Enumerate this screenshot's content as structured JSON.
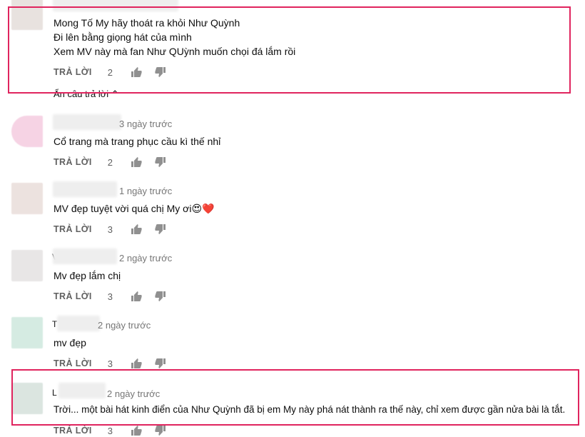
{
  "colors": {
    "highlight": "#e0245e",
    "meta_text": "#767676",
    "action_text": "#606060"
  },
  "comments": [
    {
      "id": "c0",
      "lines": [
        "Mong Tố My hãy thoát ra khỏi Như Quỳnh",
        "Đi lên bằng giọng hát của mình",
        "Xem MV này mà fan Như QUỳnh muốn chọi đá lắm rồi"
      ],
      "reply_label": "TRẢ LỜI",
      "likes": "2",
      "avatar_color": "#e8e2df",
      "hide_replies_label": "Ẩn câu trả lời ⌃"
    },
    {
      "id": "c1",
      "name_initial": "",
      "time": "3 ngày trước",
      "lines": [
        "Cổ trang mà trang phục cầu kì thế nhỉ"
      ],
      "reply_label": "TRẢ LỜI",
      "likes": "2",
      "avatar_color": "#f6d3e4"
    },
    {
      "id": "c2",
      "name_initial": "",
      "time": "1 ngày trước",
      "lines": [
        "MV đẹp tuyệt vời quá chị My ơi"
      ],
      "emoji": "😍❤️",
      "reply_label": "TRẢ LỜI",
      "likes": "3",
      "avatar_color": "#ece2df"
    },
    {
      "id": "c3",
      "name_initial": "V",
      "time": "2 ngày trước",
      "lines": [
        "Mv đẹp lắm chị"
      ],
      "reply_label": "TRẢ LỜI",
      "likes": "3",
      "avatar_color": "#e8e6e6"
    },
    {
      "id": "c4",
      "name_initial": "T",
      "time": "2 ngày trước",
      "lines": [
        "mv đẹp"
      ],
      "reply_label": "TRẢ LỜI",
      "likes": "3",
      "avatar_color": "#d5ebe2"
    },
    {
      "id": "c5",
      "name_initial": "L",
      "time": "2 ngày trước",
      "lines": [
        "Trời... một bài hát kinh điển của Như Quỳnh đã bị em My này phá nát thành ra thế này, chỉ xem được gần nửa bài là tắt."
      ],
      "reply_label": "TRẢ LỜI",
      "likes": "3",
      "avatar_color": "#dbe5e0"
    }
  ]
}
